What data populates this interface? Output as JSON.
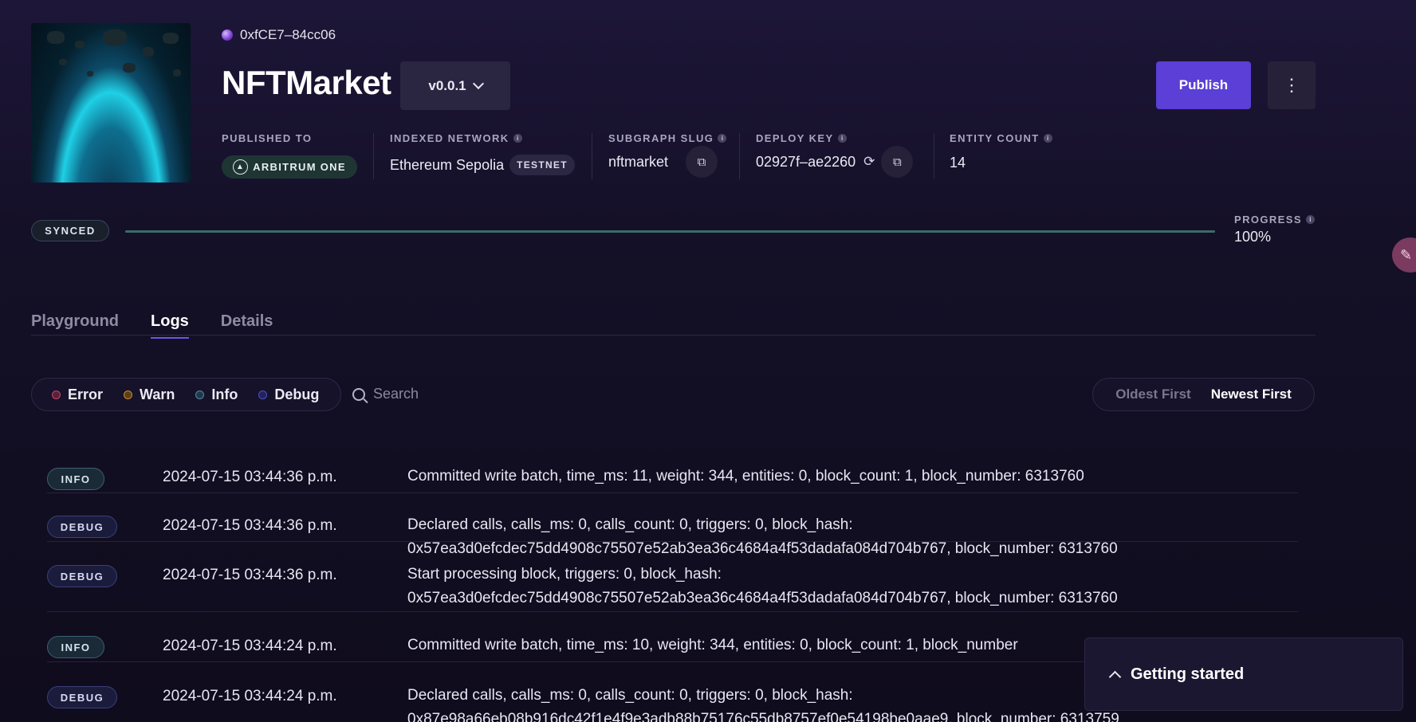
{
  "subgraph": {
    "address": "0xfCE7–84cc06",
    "name": "NFTMarket",
    "version": "v0.0.1",
    "publish_label": "Publish",
    "more_label": "⋮"
  },
  "meta": {
    "published_to": {
      "label": "PUBLISHED TO",
      "value": "ARBITRUM ONE"
    },
    "indexed_network": {
      "label": "INDEXED NETWORK",
      "value": "Ethereum Sepolia",
      "badge": "TESTNET"
    },
    "subgraph_slug": {
      "label": "SUBGRAPH SLUG",
      "value": "nftmarket"
    },
    "deploy_key": {
      "label": "DEPLOY KEY",
      "value": "02927f–ae2260"
    },
    "entity_count": {
      "label": "ENTITY COUNT",
      "value": "14"
    }
  },
  "sync": {
    "status": "SYNCED",
    "progress_label": "PROGRESS",
    "progress_value": "100%",
    "progress_fraction": 1.0
  },
  "tabs": [
    {
      "label": "Playground",
      "active": false
    },
    {
      "label": "Logs",
      "active": true
    },
    {
      "label": "Details",
      "active": false
    }
  ],
  "filters": [
    {
      "label": "Error",
      "color": "#c2456e"
    },
    {
      "label": "Warn",
      "color": "#c98a2a"
    },
    {
      "label": "Info",
      "color": "#4f8aa8"
    },
    {
      "label": "Debug",
      "color": "#4a4fc4"
    }
  ],
  "search": {
    "placeholder": "Search"
  },
  "sort": {
    "oldest": "Oldest First",
    "newest": "Newest First",
    "selected": "Newest First"
  },
  "logs": [
    {
      "level": "INFO",
      "time": "2024-07-15 03:44:36 p.m.",
      "message": "Committed write batch, time_ms: 11, weight: 344, entities: 0, block_count: 1, block_number: 6313760"
    },
    {
      "level": "DEBUG",
      "time": "2024-07-15 03:44:36 p.m.",
      "message": "Declared calls, calls_ms: 0, calls_count: 0, triggers: 0, block_hash: 0x57ea3d0efcdec75dd4908c75507e52ab3ea36c4684a4f53dadafa084d704b767, block_number: 6313760"
    },
    {
      "level": "DEBUG",
      "time": "2024-07-15 03:44:36 p.m.",
      "message": "Start processing block, triggers: 0, block_hash: 0x57ea3d0efcdec75dd4908c75507e52ab3ea36c4684a4f53dadafa084d704b767, block_number: 6313760"
    },
    {
      "level": "INFO",
      "time": "2024-07-15 03:44:24 p.m.",
      "message": "Committed write batch, time_ms: 10, weight: 344, entities: 0, block_count: 1, block_number"
    },
    {
      "level": "DEBUG",
      "time": "2024-07-15 03:44:24 p.m.",
      "message": "Declared calls, calls_ms: 0, calls_count: 0, triggers: 0, block_hash: 0x87e98a66eb08b916dc42f1e4f9e3adb88b75176c55db8757ef0e54198be0aae9, block_number: 6313759"
    }
  ],
  "getting_started": {
    "label": "Getting started"
  }
}
